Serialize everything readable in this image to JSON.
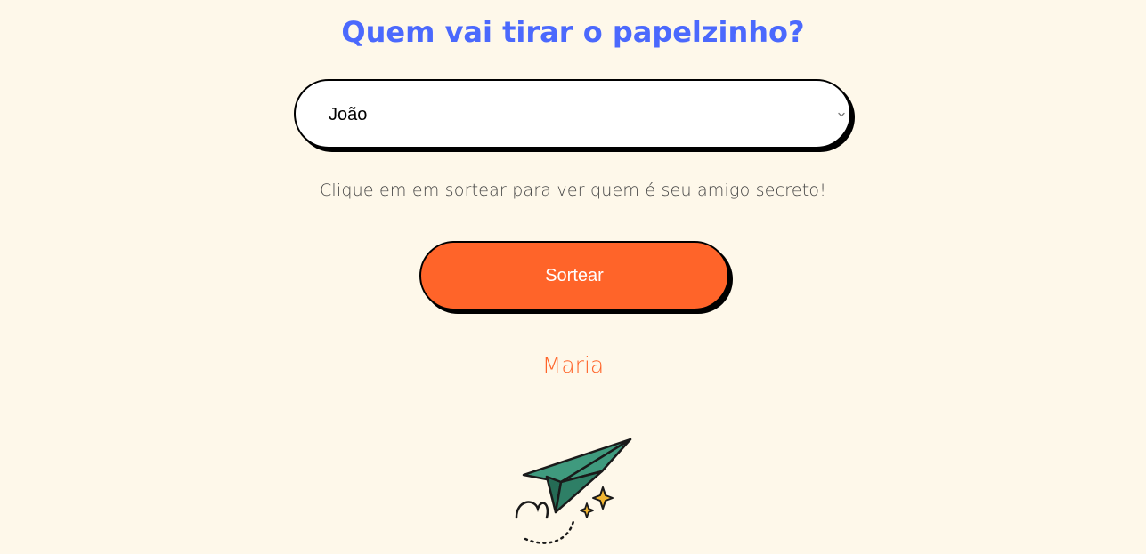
{
  "header": {
    "title": "Quem vai tirar o papelzinho?"
  },
  "participant_select": {
    "selected_value": "João",
    "icon": "chevron-down-icon"
  },
  "instructions": {
    "text": "Clique em em sortear para ver quem é seu amigo secreto!"
  },
  "draw_button": {
    "label": "Sortear"
  },
  "result": {
    "name": "Maria"
  },
  "illustration": {
    "icon": "paper-plane-icon"
  },
  "colors": {
    "background": "#FEF8EA",
    "title": "#4B69FD",
    "accent": "#FF6429",
    "plane": "#3F9A7E",
    "sparkle": "#F2B632"
  }
}
